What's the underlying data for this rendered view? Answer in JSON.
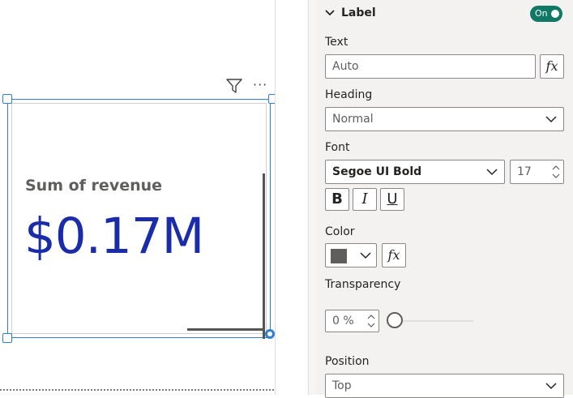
{
  "canvas": {
    "card": {
      "label": "Sum of revenue",
      "value": "$0.17M"
    },
    "header_icons": [
      "filter-icon",
      "more-options-icon"
    ],
    "more_glyph": "···"
  },
  "format_pane": {
    "section": {
      "title": "Label",
      "toggle_label": "On",
      "toggle_on": true,
      "toggle_color": "#117865"
    },
    "text": {
      "label": "Text",
      "value": "Auto",
      "fx_label": "fx"
    },
    "heading": {
      "label": "Heading",
      "value": "Normal"
    },
    "font": {
      "label": "Font",
      "family": "Segoe UI Bold",
      "size": "17",
      "bold": "B",
      "italic": "I",
      "underline": "U"
    },
    "color": {
      "label": "Color",
      "swatch": "#605e5c",
      "fx_label": "fx"
    },
    "transparency": {
      "label": "Transparency",
      "value": "0 %",
      "level_percent": 0
    },
    "position": {
      "label": "Position",
      "value": "Top"
    }
  },
  "colors": {
    "accent": "#2f7fd3",
    "value_text": "#1a2ca8"
  }
}
